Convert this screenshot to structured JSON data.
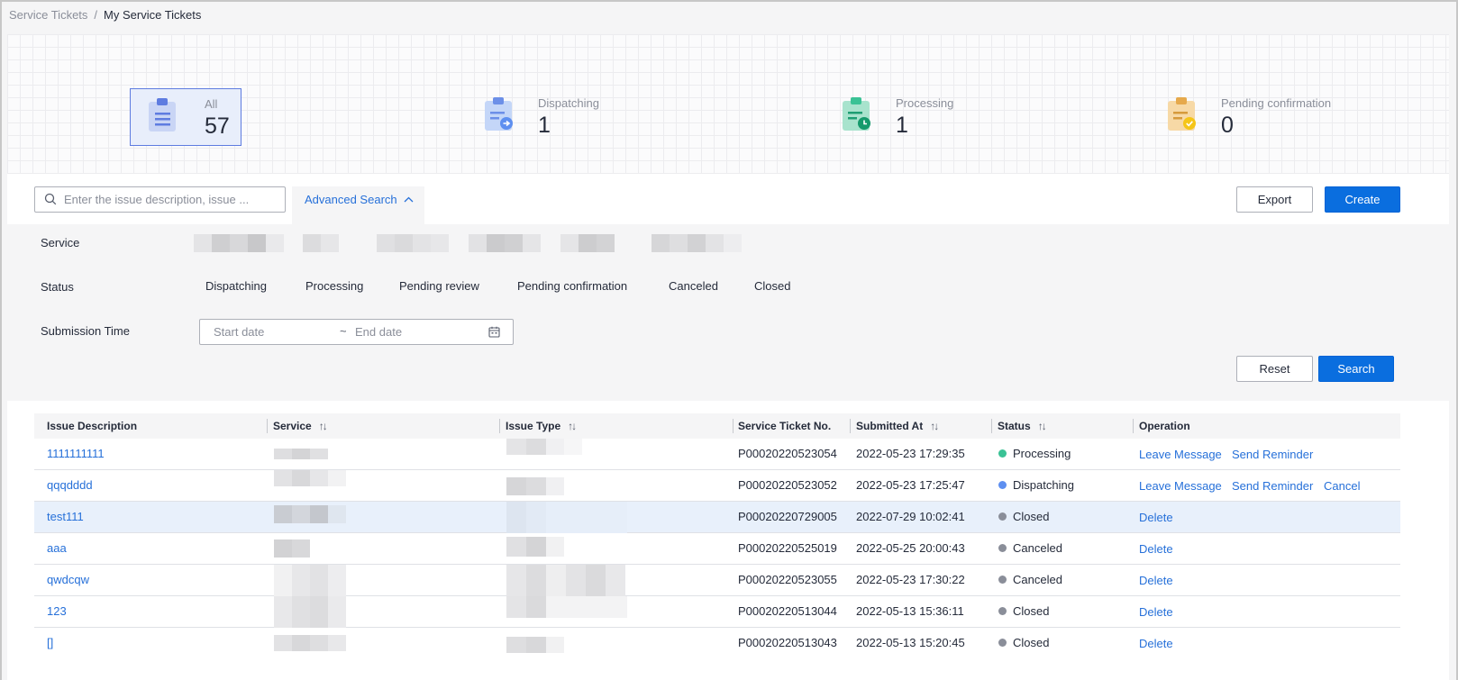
{
  "breadcrumb": {
    "parent": "Service Tickets",
    "separator": "/",
    "current": "My Service Tickets"
  },
  "stats": [
    {
      "label": "All",
      "value": "57",
      "icon": "clipboard-list-icon",
      "color": "#5e7ce0"
    },
    {
      "label": "Dispatching",
      "value": "1",
      "icon": "clipboard-dispatch-icon",
      "color": "#6c8fe8"
    },
    {
      "label": "Processing",
      "value": "1",
      "icon": "clipboard-clock-icon",
      "color": "#3ac295"
    },
    {
      "label": "Pending confirmation",
      "value": "0",
      "icon": "clipboard-check-icon",
      "color": "#f0c36a"
    }
  ],
  "toolbar": {
    "search_placeholder": "Enter the issue description, issue ...",
    "advanced_search": "Advanced Search",
    "export": "Export",
    "create": "Create"
  },
  "filters": {
    "service_label": "Service",
    "status_label": "Status",
    "status_options": [
      "Dispatching",
      "Processing",
      "Pending review",
      "Pending confirmation",
      "Canceled",
      "Closed"
    ],
    "time_label": "Submission Time",
    "start_placeholder": "Start date",
    "range_separator": "~",
    "end_placeholder": "End date",
    "reset": "Reset",
    "search": "Search"
  },
  "table": {
    "columns": {
      "issue_description": "Issue Description",
      "service": "Service",
      "issue_type": "Issue Type",
      "ticket_no": "Service Ticket No.",
      "submitted_at": "Submitted At",
      "status": "Status",
      "operation": "Operation"
    },
    "rows": [
      {
        "issue": "1111111111",
        "ticket_no": "P00020220523054",
        "submitted_at": "2022-05-23 17:29:35",
        "status": "Processing",
        "status_color": "#3ac295",
        "ops": [
          "Leave Message",
          "Send Reminder"
        ]
      },
      {
        "issue": "qqqdddd",
        "ticket_no": "P00020220523052",
        "submitted_at": "2022-05-23 17:25:47",
        "status": "Dispatching",
        "status_color": "#5e8ff0",
        "ops": [
          "Leave Message",
          "Send Reminder",
          "Cancel"
        ]
      },
      {
        "issue": "test111",
        "ticket_no": "P00020220729005",
        "submitted_at": "2022-07-29 10:02:41",
        "status": "Closed",
        "status_color": "#8a8e99",
        "ops": [
          "Delete"
        ]
      },
      {
        "issue": "aaa",
        "ticket_no": "P00020220525019",
        "submitted_at": "2022-05-25 20:00:43",
        "status": "Canceled",
        "status_color": "#8a8e99",
        "ops": [
          "Delete"
        ]
      },
      {
        "issue": "qwdcqw",
        "ticket_no": "P00020220523055",
        "submitted_at": "2022-05-23 17:30:22",
        "status": "Canceled",
        "status_color": "#8a8e99",
        "ops": [
          "Delete"
        ]
      },
      {
        "issue": "123",
        "ticket_no": "P00020220513044",
        "submitted_at": "2022-05-13 15:36:11",
        "status": "Closed",
        "status_color": "#8a8e99",
        "ops": [
          "Delete"
        ]
      },
      {
        "issue": "[]",
        "ticket_no": "P00020220513043",
        "submitted_at": "2022-05-13 15:20:45",
        "status": "Closed",
        "status_color": "#8a8e99",
        "ops": [
          "Delete"
        ]
      }
    ]
  },
  "colors": {
    "primary": "#0a6edf",
    "link": "#2670d9",
    "active_card_border": "#5e7ce0"
  }
}
